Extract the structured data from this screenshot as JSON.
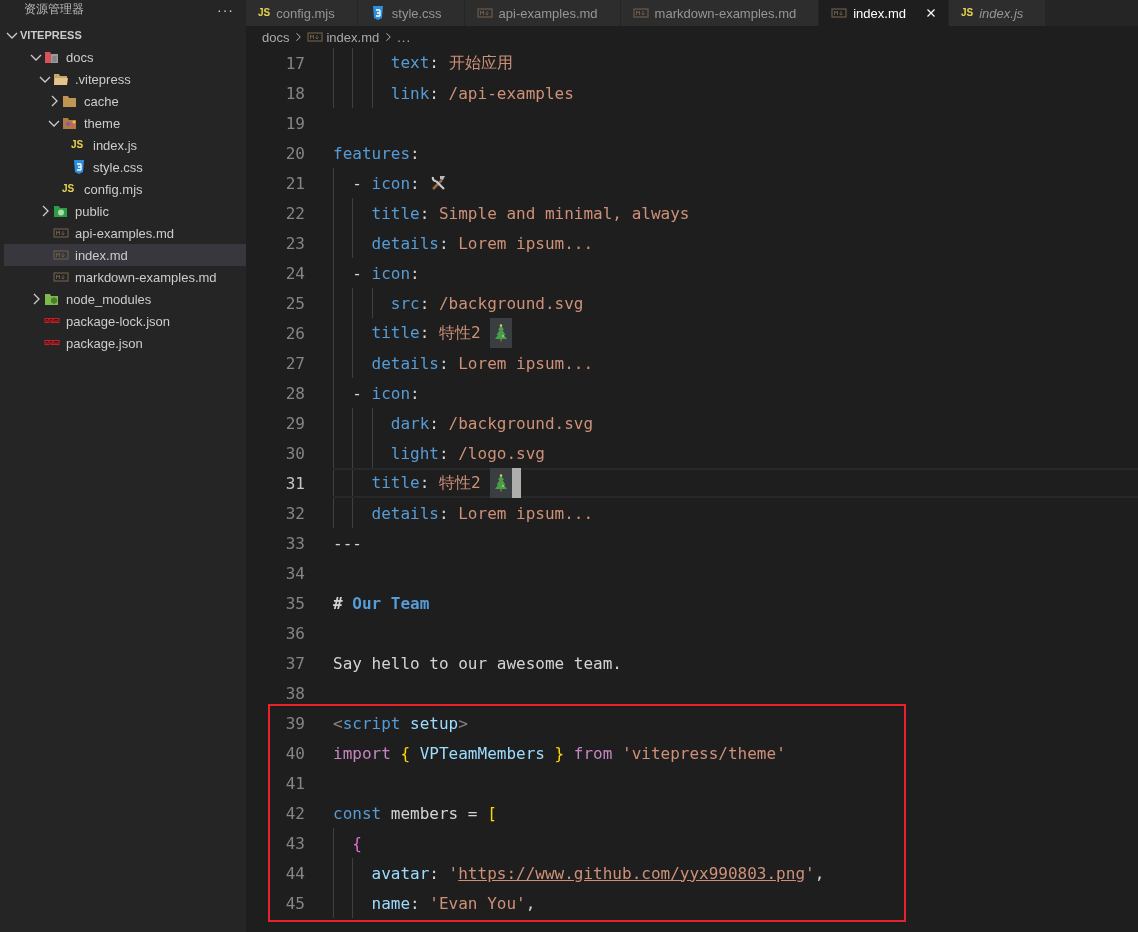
{
  "sidebar": {
    "title": "资源管理器",
    "more": "···",
    "root": {
      "label": "VITEPRESS",
      "expanded": true
    },
    "tree": [
      {
        "label": "docs",
        "kind": "docs",
        "expanded": true,
        "selected": false,
        "children": [
          {
            "label": ".vitepress",
            "kind": "config",
            "expanded": true,
            "selected": false,
            "children": [
              {
                "label": "cache",
                "kind": "folder",
                "expanded": false,
                "selected": false
              },
              {
                "label": "theme",
                "kind": "theme",
                "expanded": true,
                "selected": false,
                "children": [
                  {
                    "label": "index.js",
                    "kind": "js",
                    "icon_text": "JS",
                    "selected": false
                  },
                  {
                    "label": "style.css",
                    "kind": "css",
                    "selected": false
                  }
                ]
              },
              {
                "label": "config.mjs",
                "kind": "js",
                "icon_text": "JS",
                "selected": false
              }
            ]
          },
          {
            "label": "public",
            "kind": "public",
            "expanded": false,
            "selected": false
          },
          {
            "label": "api-examples.md",
            "kind": "md",
            "selected": false
          },
          {
            "label": "index.md",
            "kind": "md",
            "selected": true
          },
          {
            "label": "markdown-examples.md",
            "kind": "md",
            "selected": false
          }
        ]
      },
      {
        "label": "node_modules",
        "kind": "node",
        "expanded": false,
        "selected": false
      },
      {
        "label": "package-lock.json",
        "kind": "npm",
        "selected": false
      },
      {
        "label": "package.json",
        "kind": "npm",
        "selected": false
      }
    ]
  },
  "tabs": [
    {
      "label": "config.mjs",
      "kind": "js",
      "icon_text": "JS",
      "selected": false,
      "preview": false
    },
    {
      "label": "style.css",
      "kind": "css",
      "selected": false,
      "preview": false
    },
    {
      "label": "api-examples.md",
      "kind": "md",
      "selected": false,
      "preview": false
    },
    {
      "label": "markdown-examples.md",
      "kind": "md",
      "selected": false,
      "preview": false
    },
    {
      "label": "index.md",
      "kind": "md",
      "selected": true,
      "preview": false
    },
    {
      "label": "index.js",
      "kind": "js",
      "icon_text": "JS",
      "selected": false,
      "preview": true
    }
  ],
  "breadcrumb": [
    {
      "label": "docs",
      "kind": "folder"
    },
    {
      "label": "index.md",
      "kind": "md"
    },
    {
      "label": "...",
      "kind": "symbol"
    }
  ],
  "editor": {
    "lines": [
      {
        "n": "17",
        "current": false,
        "boxed": false,
        "tokens": [
          {
            "kind": "key",
            "text": "      text"
          },
          {
            "kind": "p",
            "text": ": "
          },
          {
            "kind": "str",
            "text": "开始应用"
          }
        ]
      },
      {
        "n": "18",
        "current": false,
        "boxed": false,
        "tokens": [
          {
            "kind": "key",
            "text": "      link"
          },
          {
            "kind": "p",
            "text": ": "
          },
          {
            "kind": "str",
            "text": "/api-examples"
          }
        ]
      },
      {
        "n": "19",
        "current": false,
        "boxed": false
      },
      {
        "n": "20",
        "current": false,
        "boxed": false,
        "tokens": [
          {
            "kind": "key",
            "text": "features"
          },
          {
            "kind": "p",
            "text": ":"
          }
        ]
      },
      {
        "n": "21",
        "current": false,
        "boxed": false,
        "tokens": [
          {
            "kind": "p",
            "text": "  - "
          },
          {
            "kind": "key",
            "text": "icon"
          },
          {
            "kind": "p",
            "text": ": "
          },
          {
            "kind": "tools"
          }
        ]
      },
      {
        "n": "22",
        "current": false,
        "boxed": false,
        "tokens": [
          {
            "kind": "key",
            "text": "    title"
          },
          {
            "kind": "p",
            "text": ": "
          },
          {
            "kind": "str",
            "text": "Simple and minimal, always"
          }
        ]
      },
      {
        "n": "23",
        "current": false,
        "boxed": false,
        "tokens": [
          {
            "kind": "key",
            "text": "    details"
          },
          {
            "kind": "p",
            "text": ": "
          },
          {
            "kind": "str",
            "text": "Lorem ipsum..."
          }
        ]
      },
      {
        "n": "24",
        "current": false,
        "boxed": false,
        "tokens": [
          {
            "kind": "p",
            "text": "  - "
          },
          {
            "kind": "key",
            "text": "icon"
          },
          {
            "kind": "p",
            "text": ":"
          }
        ]
      },
      {
        "n": "25",
        "current": false,
        "boxed": false,
        "tokens": [
          {
            "kind": "key",
            "text": "      src"
          },
          {
            "kind": "p",
            "text": ": "
          },
          {
            "kind": "str",
            "text": "/background.svg"
          }
        ]
      },
      {
        "n": "26",
        "current": false,
        "boxed": false,
        "tokens": [
          {
            "kind": "key",
            "text": "    title"
          },
          {
            "kind": "p",
            "text": ": "
          },
          {
            "kind": "str",
            "text": "特性2 "
          },
          {
            "kind": "tree"
          }
        ]
      },
      {
        "n": "27",
        "current": false,
        "boxed": false,
        "tokens": [
          {
            "kind": "key",
            "text": "    details"
          },
          {
            "kind": "p",
            "text": ": "
          },
          {
            "kind": "str",
            "text": "Lorem ipsum..."
          }
        ]
      },
      {
        "n": "28",
        "current": false,
        "boxed": false,
        "tokens": [
          {
            "kind": "p",
            "text": "  - "
          },
          {
            "kind": "key",
            "text": "icon"
          },
          {
            "kind": "p",
            "text": ":"
          }
        ]
      },
      {
        "n": "29",
        "current": false,
        "boxed": false,
        "tokens": [
          {
            "kind": "key",
            "text": "      dark"
          },
          {
            "kind": "p",
            "text": ": "
          },
          {
            "kind": "str",
            "text": "/background.svg"
          }
        ]
      },
      {
        "n": "30",
        "current": false,
        "boxed": false,
        "tokens": [
          {
            "kind": "key",
            "text": "      light"
          },
          {
            "kind": "p",
            "text": ": "
          },
          {
            "kind": "str",
            "text": "/logo.svg"
          }
        ]
      },
      {
        "n": "31",
        "current": true,
        "boxed": false,
        "tokens": [
          {
            "kind": "key",
            "text": "    title"
          },
          {
            "kind": "p",
            "text": ": "
          },
          {
            "kind": "str",
            "text": "特性2 "
          },
          {
            "kind": "tree"
          }
        ]
      },
      {
        "n": "32",
        "current": false,
        "boxed": false,
        "tokens": [
          {
            "kind": "key",
            "text": "    details"
          },
          {
            "kind": "p",
            "text": ": "
          },
          {
            "kind": "str",
            "text": "Lorem ipsum..."
          }
        ]
      },
      {
        "n": "33",
        "current": false,
        "boxed": false,
        "tokens": [
          {
            "kind": "p",
            "text": "---"
          }
        ]
      },
      {
        "n": "34",
        "current": false,
        "boxed": false
      },
      {
        "n": "35",
        "current": false,
        "boxed": false,
        "tokens": [
          {
            "kind": "hmark",
            "text": "# "
          },
          {
            "kind": "heading",
            "text": "Our Team"
          }
        ]
      },
      {
        "n": "36",
        "current": false,
        "boxed": false
      },
      {
        "n": "37",
        "current": false,
        "boxed": false,
        "tokens": [
          {
            "kind": "p",
            "text": "Say hello to our awesome team."
          }
        ]
      },
      {
        "n": "38",
        "current": false,
        "boxed": false
      },
      {
        "n": "39",
        "current": false,
        "boxed": true,
        "tokens": [
          {
            "kind": "angle",
            "text": "<"
          },
          {
            "kind": "tag",
            "text": "script"
          },
          {
            "kind": "var",
            "text": " setup"
          },
          {
            "kind": "angle",
            "text": ">"
          }
        ]
      },
      {
        "n": "40",
        "current": false,
        "boxed": true,
        "tokens": [
          {
            "kind": "kw",
            "text": "import"
          },
          {
            "kind": "b1",
            "text": " { "
          },
          {
            "kind": "var",
            "text": "VPTeamMembers"
          },
          {
            "kind": "b1",
            "text": " } "
          },
          {
            "kind": "kw",
            "text": "from"
          },
          {
            "kind": "str",
            "text": " 'vitepress/theme'"
          }
        ]
      },
      {
        "n": "41",
        "current": false,
        "boxed": true
      },
      {
        "n": "42",
        "current": false,
        "boxed": true,
        "tokens": [
          {
            "kind": "const",
            "text": "const"
          },
          {
            "kind": "p",
            "text": " members = "
          },
          {
            "kind": "b1",
            "text": "["
          }
        ]
      },
      {
        "n": "43",
        "current": false,
        "boxed": true,
        "tokens": [
          {
            "kind": "b2",
            "text": "  {"
          }
        ]
      },
      {
        "n": "44",
        "current": false,
        "boxed": true,
        "tokens": [
          {
            "kind": "var",
            "text": "    avatar"
          },
          {
            "kind": "p",
            "text": ": "
          },
          {
            "kind": "str",
            "text": "'"
          },
          {
            "kind": "link",
            "text": "https://www.github.com/yyx990803.png"
          },
          {
            "kind": "str",
            "text": "'"
          },
          {
            "kind": "p",
            "text": ","
          }
        ]
      },
      {
        "n": "45",
        "current": false,
        "boxed": true,
        "tokens": [
          {
            "kind": "var",
            "text": "    name"
          },
          {
            "kind": "p",
            "text": ": "
          },
          {
            "kind": "str",
            "text": "'Evan You'"
          },
          {
            "kind": "p",
            "text": ","
          }
        ]
      }
    ]
  }
}
